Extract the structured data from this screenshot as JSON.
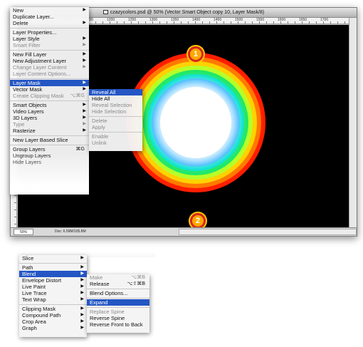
{
  "document": {
    "title": "czazycolors.psd @ 50% (Vector Smart Object copy 10, Layer Mask/8)",
    "zoom": "50%",
    "status": "Doc: 6.59M/105.8M",
    "ruler_numbers": [
      "1000",
      "1050",
      "1100",
      "1150",
      "1200",
      "1250",
      "1300",
      "1350",
      "1400",
      "1450",
      "1500",
      "1550",
      "1600",
      "1650",
      "1700"
    ]
  },
  "canvas": {
    "marker_1": "1",
    "marker_2": "2",
    "ring_colors": [
      "#ff1e00",
      "#ff7a00",
      "#ffd200",
      "#b6ff2a",
      "#1ee86a",
      "#00e0d0",
      "#17a9ff",
      "#ffffff"
    ]
  },
  "layer_menu": {
    "items": [
      {
        "label": "New",
        "arrow": true,
        "disabled": false
      },
      {
        "label": "Duplicate Layer...",
        "arrow": false,
        "disabled": false
      },
      {
        "label": "Delete",
        "arrow": true,
        "disabled": false
      },
      {
        "sep": true
      },
      {
        "label": "Layer Properties...",
        "arrow": false,
        "disabled": false
      },
      {
        "label": "Layer Style",
        "arrow": true,
        "disabled": false
      },
      {
        "label": "Smart Filter",
        "arrow": true,
        "disabled": true
      },
      {
        "sep": true
      },
      {
        "label": "New Fill Layer",
        "arrow": true,
        "disabled": false
      },
      {
        "label": "New Adjustment Layer",
        "arrow": true,
        "disabled": false
      },
      {
        "label": "Change Layer Content",
        "arrow": true,
        "disabled": true
      },
      {
        "label": "Layer Content Options...",
        "arrow": false,
        "disabled": true
      },
      {
        "sep": true
      },
      {
        "label": "Layer Mask",
        "arrow": true,
        "disabled": false,
        "active": true
      },
      {
        "label": "Vector Mask",
        "arrow": true,
        "disabled": false
      },
      {
        "label": "Create Clipping Mask",
        "shortcut": "⌥⌘G",
        "disabled": true
      },
      {
        "sep": true
      },
      {
        "label": "Smart Objects",
        "arrow": true,
        "disabled": false
      },
      {
        "label": "Video Layers",
        "arrow": true,
        "disabled": false
      },
      {
        "label": "3D Layers",
        "arrow": true,
        "disabled": false
      },
      {
        "label": "Type",
        "arrow": true,
        "disabled": true
      },
      {
        "label": "Rasterize",
        "arrow": true,
        "disabled": false
      },
      {
        "sep": true
      },
      {
        "label": "New Layer Based Slice",
        "arrow": false,
        "disabled": false
      },
      {
        "sep": true
      },
      {
        "label": "Group Layers",
        "shortcut": "⌘G",
        "disabled": false
      },
      {
        "label": "Ungroup Layers",
        "shortcut": "",
        "disabled": false
      },
      {
        "label": "Hide Layers",
        "shortcut": "",
        "disabled": false
      }
    ]
  },
  "mask_submenu": {
    "items": [
      {
        "label": "Reveal All",
        "disabled": false,
        "active": true
      },
      {
        "label": "Hide All",
        "disabled": false
      },
      {
        "label": "Reveal Selection",
        "disabled": true
      },
      {
        "label": "Hide Selection",
        "disabled": true
      },
      {
        "sep": true
      },
      {
        "label": "Delete",
        "disabled": true
      },
      {
        "label": "Apply",
        "disabled": true
      },
      {
        "sep": true
      },
      {
        "label": "Enable",
        "disabled": true
      },
      {
        "label": "Unlink",
        "disabled": true
      }
    ]
  },
  "object_menu": {
    "items": [
      {
        "label": "Slice",
        "arrow": true
      },
      {
        "sep": true
      },
      {
        "label": "Path",
        "arrow": true
      },
      {
        "label": "Blend",
        "arrow": true,
        "active": true
      },
      {
        "label": "Envelope Distort",
        "arrow": true
      },
      {
        "label": "Live Paint",
        "arrow": true
      },
      {
        "label": "Live Trace",
        "arrow": true
      },
      {
        "label": "Text Wrap",
        "arrow": true
      },
      {
        "sep": true
      },
      {
        "label": "Clipping Mask",
        "arrow": true
      },
      {
        "label": "Compound Path",
        "arrow": true
      },
      {
        "label": "Crop Area",
        "arrow": true
      },
      {
        "label": "Graph",
        "arrow": true
      }
    ]
  },
  "blend_submenu": {
    "items": [
      {
        "label": "Make",
        "shortcut": "⌥⌘B",
        "disabled": true
      },
      {
        "label": "Release",
        "shortcut": "⌥⇧⌘B",
        "disabled": false
      },
      {
        "sep": true
      },
      {
        "label": "Blend Options...",
        "shortcut": "",
        "disabled": false
      },
      {
        "sep": true
      },
      {
        "label": "Expand",
        "shortcut": "",
        "disabled": false,
        "active": true
      },
      {
        "sep": true
      },
      {
        "label": "Replace Spine",
        "shortcut": "",
        "disabled": true
      },
      {
        "label": "Reverse Spine",
        "shortcut": "",
        "disabled": false
      },
      {
        "label": "Reverse Front to Back",
        "shortcut": "",
        "disabled": false
      }
    ]
  }
}
